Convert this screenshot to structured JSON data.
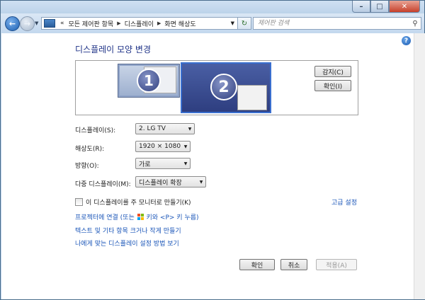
{
  "address_bar": {
    "overflow": "«",
    "segments": [
      "모든 제어판 항목",
      "디스플레이",
      "화면 해상도"
    ]
  },
  "search": {
    "placeholder": "제어판 검색"
  },
  "page": {
    "title": "디스플레이 모양 변경"
  },
  "preview": {
    "monitor1_number": "1",
    "monitor2_number": "2",
    "detect_button": "감지(C)",
    "identify_button": "확인(I)"
  },
  "settings": {
    "display_label": "디스플레이(S):",
    "display_value": "2. LG TV",
    "resolution_label": "해상도(R):",
    "resolution_value": "1920 × 1080",
    "orientation_label": "방향(O):",
    "orientation_value": "가로",
    "multi_label": "다중 디스플레이(M):",
    "multi_value": "디스플레이 확장"
  },
  "main_monitor_checkbox": {
    "label": "이 디스플레이를 주 모니터로 만들기(K)",
    "checked": false
  },
  "advanced_link": "고급 설정",
  "links": {
    "projector_prefix": "프로젝터에 연결 (또는",
    "projector_suffix": "키와 <P> 키 누름)",
    "text_size": "텍스트 및 기타 항목 크거나 작게 만들기",
    "help": "나에게 맞는 디스플레이 설정 방법 보기"
  },
  "buttons": {
    "ok": "확인",
    "cancel": "취소",
    "apply": "적용(A)"
  },
  "colors": {
    "link": "#1a55b8",
    "title": "#1e3287",
    "frame": "#b9d1ea"
  },
  "icons": [
    "minimize-icon",
    "maximize-icon",
    "close-icon",
    "back-arrow-icon",
    "forward-arrow-icon",
    "control-panel-icon",
    "refresh-icon",
    "search-icon",
    "help-icon",
    "windows-logo-icon"
  ]
}
